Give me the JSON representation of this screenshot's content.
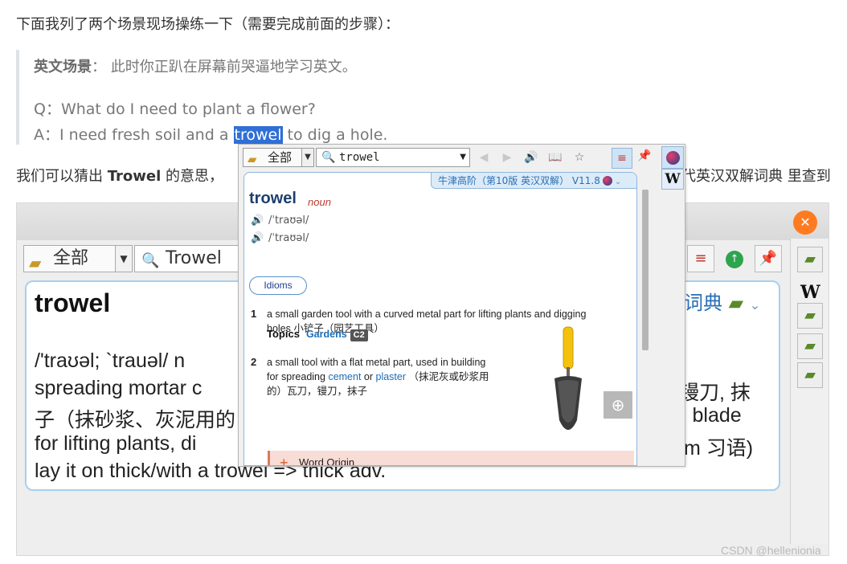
{
  "article": {
    "intro": "下面我列了两个场景现场操练一下（需要完成前面的步骤）：",
    "scene_label": "英文场景",
    "scene_text": "：  此时你正趴在屏幕前哭逼地学习英文。",
    "q_line": "Q：What do I need to plant a flower?",
    "a_prefix": "A：I need fresh soil and a ",
    "a_highlight": "trowel",
    "a_suffix": " to dig a hole.",
    "guess_prefix": "我们可以猜出 ",
    "guess_bold": "Trowel",
    "guess_suffix": " 的意思，",
    "guess_tail": "代英汉双解词典 里查到"
  },
  "bg_window": {
    "combo_label": "全部",
    "search_value": "Trowel",
    "word": "trowel",
    "dict_name_partial": "词典",
    "lines": [
      "/'traʊəl; `trauəl/ n",
      "spreading mortar c",
      "子（抹砂浆、灰泥用的",
      "for lifting plants, di",
      "lay it on thick/with a trowel => thick adv."
    ],
    "right_fragments": [
      "镘刀, 抹",
      "l blade",
      "m 习语)"
    ]
  },
  "popup": {
    "combo_label": "全部",
    "search_value": "trowel",
    "dict_tab": "牛津高阶（第10版 英汉双解） V11.8",
    "headword": "trowel",
    "pos": "noun",
    "pron_uk": "/ˈtraʊəl/",
    "pron_us": "/ˈtraʊəl/",
    "idioms_label": "Idioms",
    "sense1_num": "1",
    "sense1_line1": "a small garden tool with a curved metal part for lifting plants and digging",
    "sense1_line2": "holes 小铲子（园艺工具）",
    "topics_label": "Topics",
    "topics_value": "Gardens",
    "topics_level": "C2",
    "sense2_num": "2",
    "sense2_line1": "a small tool with a flat metal part, used in building",
    "sense2_line2_a": "for spreading ",
    "sense2_link1": "cement",
    "sense2_line2_b": " or ",
    "sense2_link2": "plaster",
    "sense2_line2_c": " （抹泥灰或砂浆用",
    "sense2_line3": "的）瓦刀，镘刀，抹子",
    "word_origin": "Word Origin"
  },
  "watermark": "CSDN @hellenionia",
  "icons": {
    "combo": "book-icon",
    "search": "magnifier-icon",
    "back": "back-arrow-icon",
    "forward": "forward-arrow-icon",
    "speaker": "speaker-icon",
    "open_book": "open-book-icon",
    "star": "star-icon",
    "books": "books-icon",
    "pin": "pin-icon",
    "globe": "globe-icon",
    "wikipedia": "wikipedia-icon",
    "zoom": "zoom-in-icon"
  },
  "colors": {
    "highlight": "#2f6fd6",
    "headword": "#1d3f6e",
    "pos": "#c0392b",
    "link": "#1d6db5",
    "origin_bg": "#f8dcd6",
    "close": "#ff7b21"
  }
}
